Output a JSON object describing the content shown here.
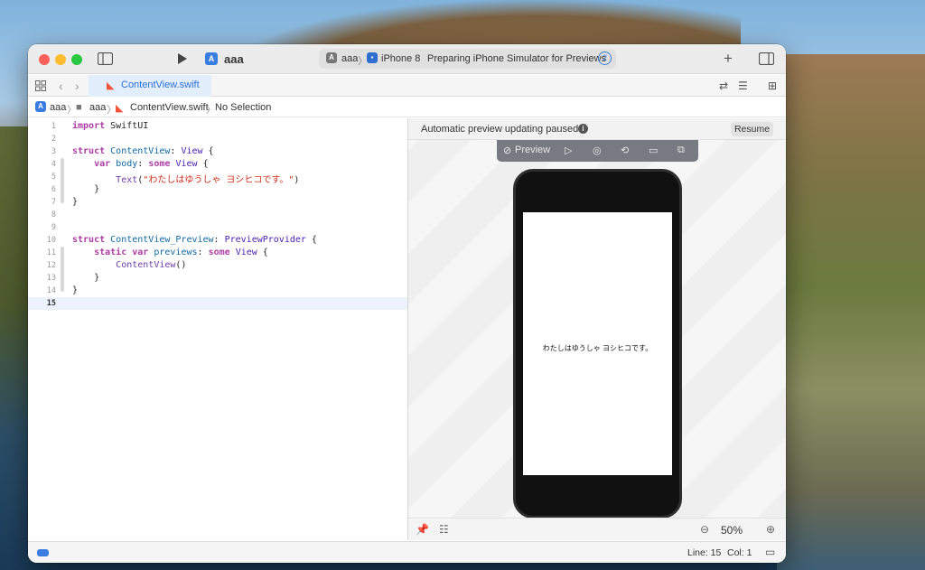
{
  "window": {
    "scheme": "aaa",
    "activity": {
      "target_app": "aaa",
      "device": "iPhone 8",
      "status": "Preparing iPhone Simulator for Previews",
      "badge": "2"
    }
  },
  "tabs": [
    {
      "label": "ContentView.swift"
    }
  ],
  "jumpbar": [
    "aaa",
    "aaa",
    "ContentView.swift",
    "No Selection"
  ],
  "code": [
    {
      "n": "1",
      "t": [
        [
          "kw",
          "import"
        ],
        [
          "pl",
          " SwiftUI"
        ]
      ]
    },
    {
      "n": "2",
      "t": []
    },
    {
      "n": "3",
      "t": [
        [
          "kw",
          "struct"
        ],
        [
          "pl",
          " "
        ],
        [
          "df",
          "ContentView"
        ],
        [
          "pl",
          ": "
        ],
        [
          "ty",
          "View"
        ],
        [
          "pl",
          " {"
        ]
      ]
    },
    {
      "n": "4",
      "t": [
        [
          "pl",
          "    "
        ],
        [
          "kw",
          "var"
        ],
        [
          "pl",
          " "
        ],
        [
          "df",
          "body"
        ],
        [
          "pl",
          ": "
        ],
        [
          "kw",
          "some"
        ],
        [
          "pl",
          " "
        ],
        [
          "ty",
          "View"
        ],
        [
          "pl",
          " {"
        ]
      ]
    },
    {
      "n": "5",
      "t": [
        [
          "pl",
          "        "
        ],
        [
          "tyd",
          "Text"
        ],
        [
          "pl",
          "("
        ],
        [
          "st",
          "\"わたしはゆうしゃ ヨシヒコです。\""
        ],
        [
          "pl",
          ")"
        ]
      ]
    },
    {
      "n": "6",
      "t": [
        [
          "pl",
          "    }"
        ]
      ]
    },
    {
      "n": "7",
      "t": [
        [
          "pl",
          "}"
        ]
      ]
    },
    {
      "n": "8",
      "t": []
    },
    {
      "n": "9",
      "t": []
    },
    {
      "n": "10",
      "t": [
        [
          "kw",
          "struct"
        ],
        [
          "pl",
          " "
        ],
        [
          "df",
          "ContentView_Preview"
        ],
        [
          "pl",
          ": "
        ],
        [
          "ty",
          "PreviewProvider"
        ],
        [
          "pl",
          " {"
        ]
      ]
    },
    {
      "n": "11",
      "t": [
        [
          "pl",
          "    "
        ],
        [
          "kw",
          "static"
        ],
        [
          "pl",
          " "
        ],
        [
          "kw",
          "var"
        ],
        [
          "pl",
          " "
        ],
        [
          "df",
          "previews"
        ],
        [
          "pl",
          ": "
        ],
        [
          "kw",
          "some"
        ],
        [
          "pl",
          " "
        ],
        [
          "ty",
          "View"
        ],
        [
          "pl",
          " {"
        ]
      ]
    },
    {
      "n": "12",
      "t": [
        [
          "pl",
          "        "
        ],
        [
          "tyd",
          "ContentView"
        ],
        [
          "pl",
          "()"
        ]
      ]
    },
    {
      "n": "13",
      "t": [
        [
          "pl",
          "    }"
        ]
      ]
    },
    {
      "n": "14",
      "t": [
        [
          "pl",
          "}"
        ]
      ]
    },
    {
      "n": "15",
      "t": []
    }
  ],
  "current_line": "15",
  "canvas": {
    "notice": "Automatic preview updating paused",
    "resume_label": "Resume",
    "toolbar_label": "Preview",
    "preview_text": "わたしはゆうしゃ ヨシヒコです。",
    "zoom": "50%"
  },
  "status": {
    "line": "Line: 15",
    "col": "Col: 1"
  },
  "colors": {
    "accent": "#3a7de1",
    "swift": "#f05138",
    "keyword": "#ad3da4",
    "string": "#d12f1b"
  }
}
